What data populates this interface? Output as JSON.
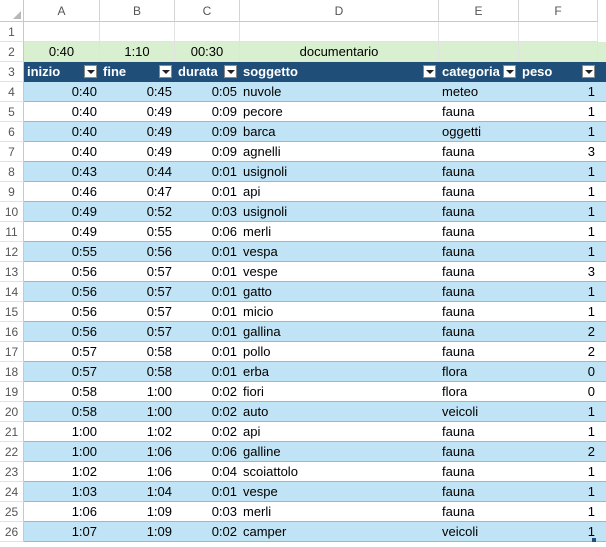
{
  "columns": [
    "A",
    "B",
    "C",
    "D",
    "E",
    "F"
  ],
  "row_numbers": [
    "1",
    "2",
    "3",
    "4",
    "5",
    "6",
    "7",
    "8",
    "9",
    "10",
    "11",
    "12",
    "13",
    "14",
    "15",
    "16",
    "17",
    "18",
    "19",
    "20",
    "21",
    "22",
    "23",
    "24",
    "25",
    "26"
  ],
  "row2": {
    "a": "0:40",
    "b": "1:10",
    "c": "00:30",
    "d": "documentario"
  },
  "headers": {
    "inizio": "inizio",
    "fine": "fine",
    "durata": "durata",
    "soggetto": "soggetto",
    "categoria": "categoria",
    "peso": "peso"
  },
  "rows": [
    {
      "inizio": "0:40",
      "fine": "0:45",
      "durata": "0:05",
      "soggetto": "nuvole",
      "categoria": "meteo",
      "peso": "1"
    },
    {
      "inizio": "0:40",
      "fine": "0:49",
      "durata": "0:09",
      "soggetto": "pecore",
      "categoria": "fauna",
      "peso": "1"
    },
    {
      "inizio": "0:40",
      "fine": "0:49",
      "durata": "0:09",
      "soggetto": "barca",
      "categoria": "oggetti",
      "peso": "1"
    },
    {
      "inizio": "0:40",
      "fine": "0:49",
      "durata": "0:09",
      "soggetto": "agnelli",
      "categoria": "fauna",
      "peso": "3"
    },
    {
      "inizio": "0:43",
      "fine": "0:44",
      "durata": "0:01",
      "soggetto": "usignoli",
      "categoria": "fauna",
      "peso": "1"
    },
    {
      "inizio": "0:46",
      "fine": "0:47",
      "durata": "0:01",
      "soggetto": "api",
      "categoria": "fauna",
      "peso": "1"
    },
    {
      "inizio": "0:49",
      "fine": "0:52",
      "durata": "0:03",
      "soggetto": "usignoli",
      "categoria": "fauna",
      "peso": "1"
    },
    {
      "inizio": "0:49",
      "fine": "0:55",
      "durata": "0:06",
      "soggetto": "merli",
      "categoria": "fauna",
      "peso": "1"
    },
    {
      "inizio": "0:55",
      "fine": "0:56",
      "durata": "0:01",
      "soggetto": "vespa",
      "categoria": "fauna",
      "peso": "1"
    },
    {
      "inizio": "0:56",
      "fine": "0:57",
      "durata": "0:01",
      "soggetto": "vespe",
      "categoria": "fauna",
      "peso": "3"
    },
    {
      "inizio": "0:56",
      "fine": "0:57",
      "durata": "0:01",
      "soggetto": "gatto",
      "categoria": "fauna",
      "peso": "1"
    },
    {
      "inizio": "0:56",
      "fine": "0:57",
      "durata": "0:01",
      "soggetto": "micio",
      "categoria": "fauna",
      "peso": "1"
    },
    {
      "inizio": "0:56",
      "fine": "0:57",
      "durata": "0:01",
      "soggetto": "gallina",
      "categoria": "fauna",
      "peso": "2"
    },
    {
      "inizio": "0:57",
      "fine": "0:58",
      "durata": "0:01",
      "soggetto": "pollo",
      "categoria": "fauna",
      "peso": "2"
    },
    {
      "inizio": "0:57",
      "fine": "0:58",
      "durata": "0:01",
      "soggetto": "erba",
      "categoria": "flora",
      "peso": "0"
    },
    {
      "inizio": "0:58",
      "fine": "1:00",
      "durata": "0:02",
      "soggetto": "fiori",
      "categoria": "flora",
      "peso": "0"
    },
    {
      "inizio": "0:58",
      "fine": "1:00",
      "durata": "0:02",
      "soggetto": "auto",
      "categoria": "veicoli",
      "peso": "1"
    },
    {
      "inizio": "1:00",
      "fine": "1:02",
      "durata": "0:02",
      "soggetto": "api",
      "categoria": "fauna",
      "peso": "1"
    },
    {
      "inizio": "1:00",
      "fine": "1:06",
      "durata": "0:06",
      "soggetto": "galline",
      "categoria": "fauna",
      "peso": "2"
    },
    {
      "inizio": "1:02",
      "fine": "1:06",
      "durata": "0:04",
      "soggetto": "scoiattolo",
      "categoria": "fauna",
      "peso": "1"
    },
    {
      "inizio": "1:03",
      "fine": "1:04",
      "durata": "0:01",
      "soggetto": "vespe",
      "categoria": "fauna",
      "peso": "1"
    },
    {
      "inizio": "1:06",
      "fine": "1:09",
      "durata": "0:03",
      "soggetto": "merli",
      "categoria": "fauna",
      "peso": "1"
    },
    {
      "inizio": "1:07",
      "fine": "1:09",
      "durata": "0:02",
      "soggetto": "camper",
      "categoria": "veicoli",
      "peso": "1"
    }
  ],
  "colors": {
    "header_bg": "#1f4e79",
    "band_bg": "#c0e4f5",
    "row2_bg": "#d8f0cf"
  },
  "icons": {
    "filter": "filter-dropdown-icon"
  }
}
